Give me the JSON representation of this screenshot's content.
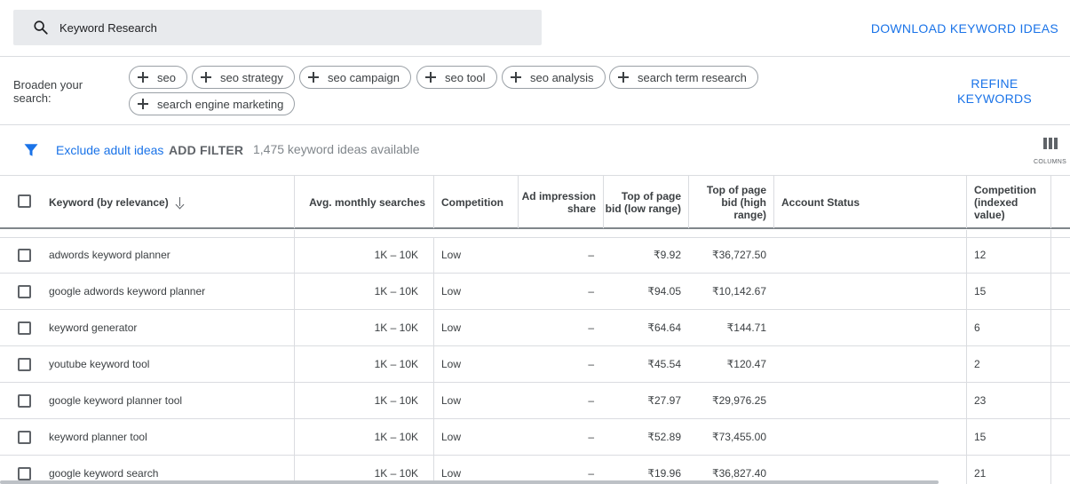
{
  "search": {
    "value": "Keyword Research"
  },
  "download_label": "DOWNLOAD KEYWORD IDEAS",
  "broaden": {
    "label": "Broaden your search:",
    "chips": [
      "seo",
      "seo strategy",
      "seo campaign",
      "seo tool",
      "seo analysis",
      "search term research",
      "search engine marketing"
    ]
  },
  "refine_label": "REFINE KEYWORDS",
  "filter_bar": {
    "exclude_label": "Exclude adult ideas",
    "add_filter_label": "ADD FILTER",
    "count_text": "1,475 keyword ideas available",
    "columns_label": "COLUMNS"
  },
  "table": {
    "headers": {
      "keyword": "Keyword (by relevance)",
      "searches": "Avg. monthly searches",
      "competition": "Competition",
      "impression_share": "Ad impression share",
      "bid_low": "Top of page bid (low range)",
      "bid_high": "Top of page bid (high range)",
      "account_status": "Account Status",
      "competition_indexed": "Competition (indexed value)"
    },
    "rows": [
      {
        "keyword": "adwords keyword planner",
        "searches": "1K – 10K",
        "competition": "Low",
        "impression_share": "–",
        "bid_low": "₹9.92",
        "bid_high": "₹36,727.50",
        "account_status": "",
        "competition_indexed": "12"
      },
      {
        "keyword": "google adwords keyword planner",
        "searches": "1K – 10K",
        "competition": "Low",
        "impression_share": "–",
        "bid_low": "₹94.05",
        "bid_high": "₹10,142.67",
        "account_status": "",
        "competition_indexed": "15"
      },
      {
        "keyword": "keyword generator",
        "searches": "1K – 10K",
        "competition": "Low",
        "impression_share": "–",
        "bid_low": "₹64.64",
        "bid_high": "₹144.71",
        "account_status": "",
        "competition_indexed": "6"
      },
      {
        "keyword": "youtube keyword tool",
        "searches": "1K – 10K",
        "competition": "Low",
        "impression_share": "–",
        "bid_low": "₹45.54",
        "bid_high": "₹120.47",
        "account_status": "",
        "competition_indexed": "2"
      },
      {
        "keyword": "google keyword planner tool",
        "searches": "1K – 10K",
        "competition": "Low",
        "impression_share": "–",
        "bid_low": "₹27.97",
        "bid_high": "₹29,976.25",
        "account_status": "",
        "competition_indexed": "23"
      },
      {
        "keyword": "keyword planner tool",
        "searches": "1K – 10K",
        "competition": "Low",
        "impression_share": "–",
        "bid_low": "₹52.89",
        "bid_high": "₹73,455.00",
        "account_status": "",
        "competition_indexed": "15"
      },
      {
        "keyword": "google keyword search",
        "searches": "1K – 10K",
        "competition": "Low",
        "impression_share": "–",
        "bid_low": "₹19.96",
        "bid_high": "₹36,827.40",
        "account_status": "",
        "competition_indexed": "21"
      }
    ]
  },
  "colors": {
    "accent": "#1a73e8",
    "text": "#3c4043",
    "divider": "#dadce0"
  }
}
